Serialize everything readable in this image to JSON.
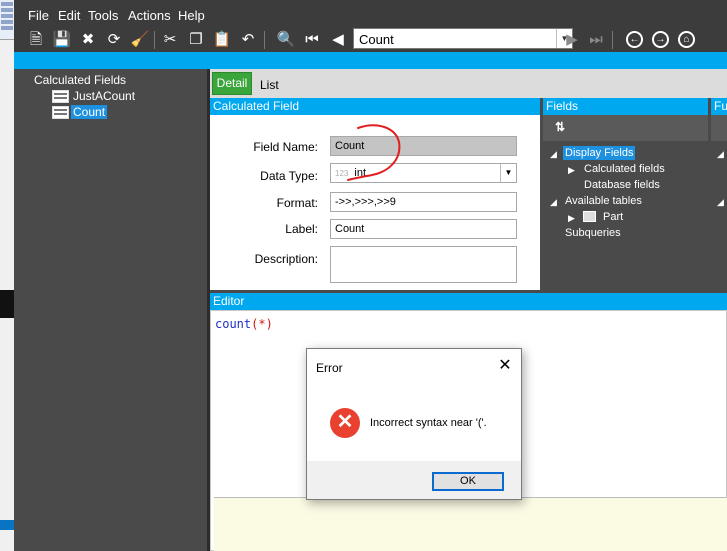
{
  "menu": {
    "items": [
      "File",
      "Edit",
      "Tools",
      "Actions",
      "Help"
    ]
  },
  "toolbar": {
    "record_select_value": "Count",
    "icons": [
      "new-icon",
      "save-icon",
      "delete-icon",
      "refresh-icon",
      "clear-icon",
      "cut-icon",
      "copy-icon",
      "paste-icon",
      "undo-icon",
      "find-icon",
      "first-record-icon",
      "previous-record-icon",
      "next-record-icon",
      "last-record-icon",
      "back-icon",
      "forward-icon",
      "home-icon"
    ]
  },
  "tree": {
    "root_label": "Calculated Fields",
    "items": [
      "JustACount",
      "Count"
    ],
    "selected": "Count"
  },
  "tabs": [
    "Detail",
    "List"
  ],
  "calculated_field": {
    "header": "Calculated Field",
    "field_name_label": "Field Name:",
    "field_name_value": "Count",
    "data_type_label": "Data Type:",
    "data_type_prefix": "123",
    "data_type_value": "int",
    "format_label": "Format:",
    "format_value": "->>,>>>,>>9",
    "label_label": "Label:",
    "label_value": "Count",
    "description_label": "Description:",
    "description_value": ""
  },
  "fields_panel": {
    "header": "Fields",
    "display_fields": "Display Fields",
    "calculated_fields": "Calculated fields",
    "database_fields": "Database fields",
    "available_tables": "Available tables",
    "table_part": "Part",
    "subqueries": "Subqueries"
  },
  "functions_panel": {
    "header": "Fu"
  },
  "editor": {
    "header": "Editor",
    "code_fn": "count",
    "code_args": "(*)"
  },
  "dialog": {
    "title": "Error",
    "message": "Incorrect syntax near '('.",
    "ok_label": "OK"
  },
  "colors": {
    "accent": "#00a8f0",
    "tab_active": "#3aa53a",
    "selection": "#1e90e0",
    "error": "#e8412f",
    "annotation": "#e02020"
  }
}
